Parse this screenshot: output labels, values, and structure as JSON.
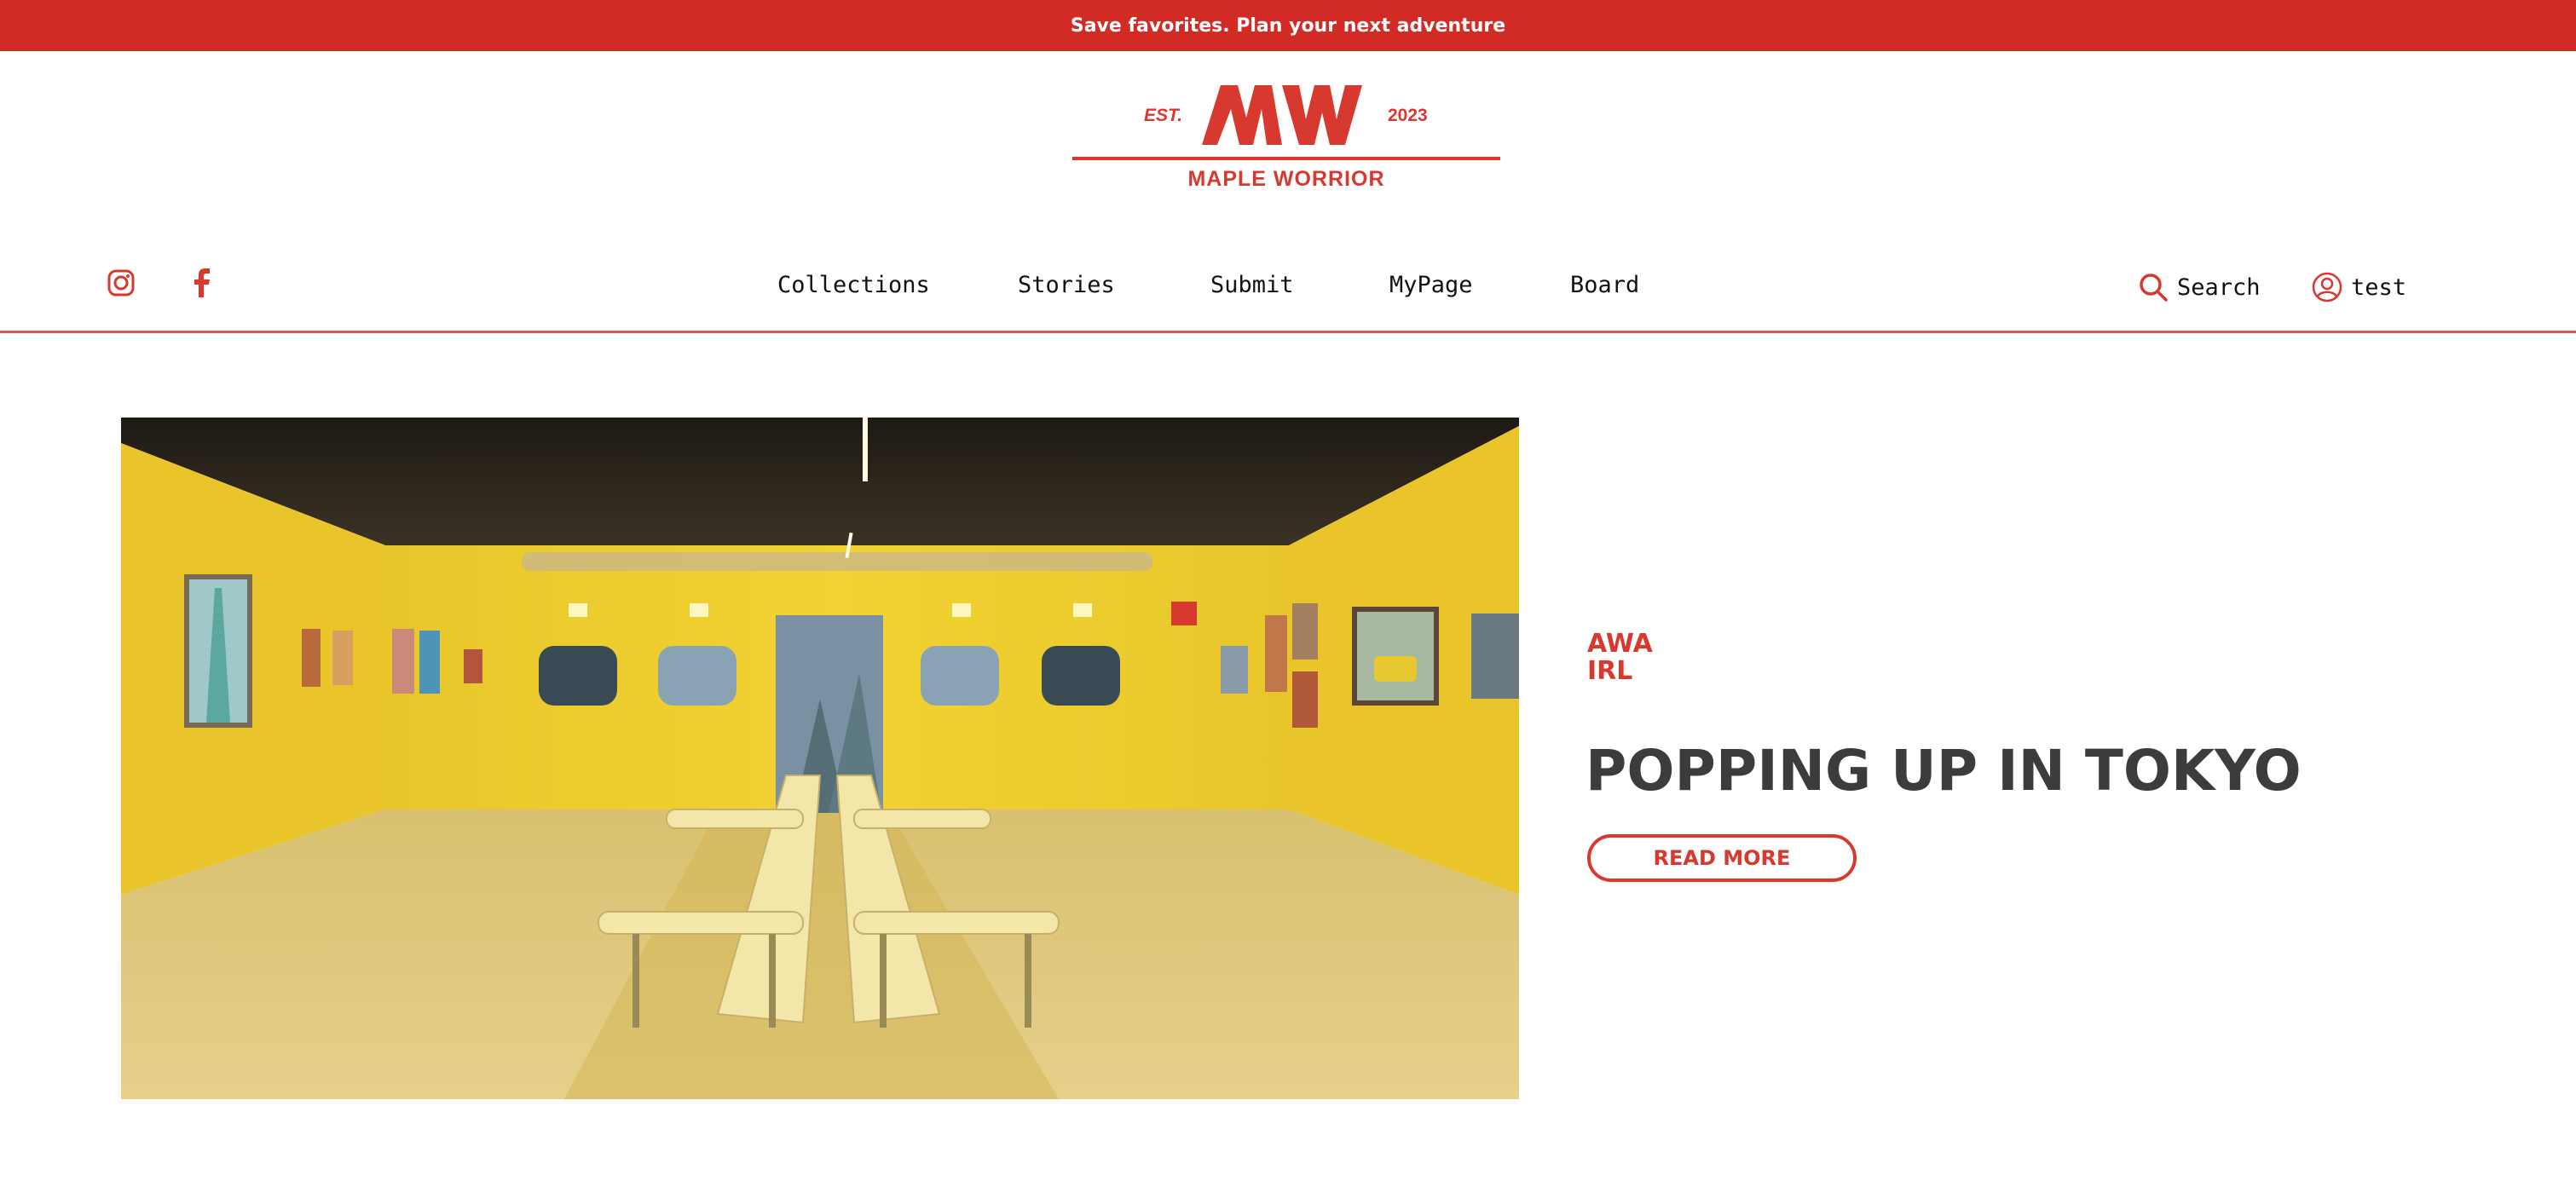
{
  "announcement": {
    "text": "Save favorites. Plan your next adventure"
  },
  "logo": {
    "est": "EST.",
    "year": "2023",
    "name": "MAPLE WORRIOR"
  },
  "social": {
    "instagram_icon": "instagram-icon",
    "facebook_icon": "facebook-icon"
  },
  "nav": {
    "items": [
      "Collections",
      "Stories",
      "Submit",
      "MyPage",
      "Board"
    ]
  },
  "utility": {
    "search_label": "Search",
    "user_label": "test"
  },
  "hero": {
    "kicker_line1": "AWA",
    "kicker_line2": "IRL",
    "headline": "POPPING UP IN TOKYO",
    "cta_label": "READ MORE"
  },
  "colors": {
    "brand_red": "#d22b26",
    "accent_red": "#d8392f",
    "headline_gray": "#3c3c3c"
  }
}
